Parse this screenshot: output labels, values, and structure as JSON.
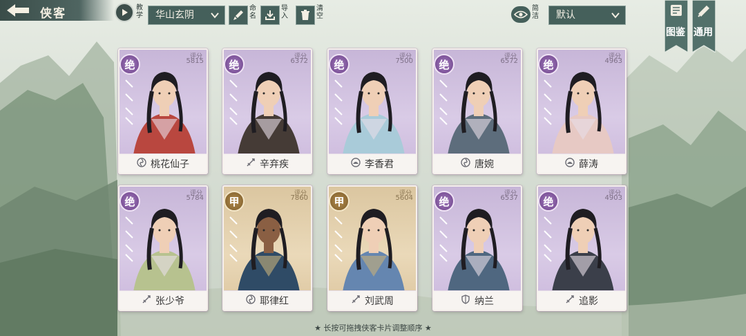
{
  "topbar": {
    "title": "侠客",
    "teach_label": "教学",
    "sect_dropdown": "华山玄阴",
    "rename_label": "命名",
    "import_label": "导入",
    "clear_label": "清空",
    "simple_label": "简洁",
    "sort_dropdown": "默认"
  },
  "banners": {
    "atlas": "图鉴",
    "general": "通用"
  },
  "score_label": "评分",
  "cards": [
    {
      "name": "桃花仙子",
      "rank": "绝",
      "score": "5815",
      "tier": "jue",
      "type_icon": "swirl-icon"
    },
    {
      "name": "辛弃疾",
      "rank": "绝",
      "score": "6372",
      "tier": "jue",
      "type_icon": "sword-icon"
    },
    {
      "name": "李香君",
      "rank": "绝",
      "score": "7500",
      "tier": "jue",
      "type_icon": "lotus-icon"
    },
    {
      "name": "唐婉",
      "rank": "绝",
      "score": "6572",
      "tier": "jue",
      "type_icon": "swirl-icon"
    },
    {
      "name": "薛涛",
      "rank": "绝",
      "score": "4963",
      "tier": "jue",
      "type_icon": "lotus-icon"
    },
    {
      "name": "张少爷",
      "rank": "绝",
      "score": "5784",
      "tier": "jue",
      "type_icon": "sword-icon"
    },
    {
      "name": "耶律红",
      "rank": "甲",
      "score": "7860",
      "tier": "jia",
      "type_icon": "swirl-icon"
    },
    {
      "name": "刘武周",
      "rank": "甲",
      "score": "5604",
      "tier": "jia",
      "type_icon": "sword-icon"
    },
    {
      "name": "纳兰",
      "rank": "绝",
      "score": "6537",
      "tier": "jue",
      "type_icon": "shield-icon"
    },
    {
      "name": "追影",
      "rank": "绝",
      "score": "4903",
      "tier": "jue",
      "type_icon": "sword-icon"
    }
  ],
  "footer": {
    "hint": "★ 长按可拖拽侠客卡片调整顺序 ★"
  }
}
